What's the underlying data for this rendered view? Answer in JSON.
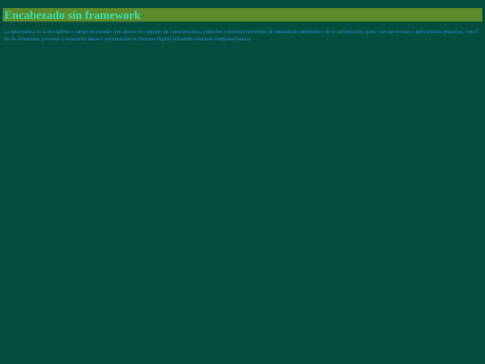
{
  "header": {
    "title": "Encabezado sin framework",
    "background_color": "#5a8a2c",
    "title_color": "#36e0b0"
  },
  "main": {
    "paragraph": "La informática es la disciplina o campo de estudio que abarca el conjunto de conocimientos, métodos y técnicas referentes al tratamiento automático de la información, junto con sus teorías y aplicaciones prácticas, con el fin de almacenar, procesar y transmitir datos e información en formato digital utilizando sistemas computacionales.",
    "text_color": "#2f86c8"
  },
  "page": {
    "background_color": "#034e3e"
  }
}
